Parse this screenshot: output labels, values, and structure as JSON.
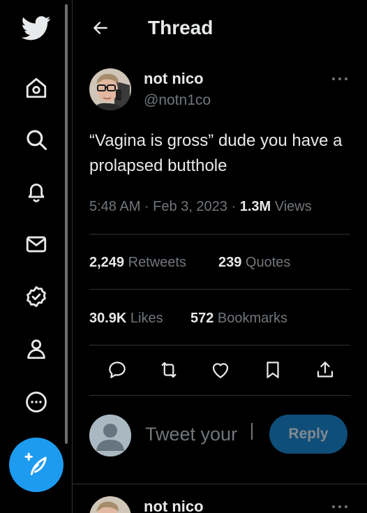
{
  "header": {
    "title": "Thread"
  },
  "tweet": {
    "author": {
      "display_name": "not nico",
      "handle": "@notn1co"
    },
    "text": "“Vagina is gross” dude you have a prolapsed butthole",
    "time": "5:48 AM",
    "sep1": " · ",
    "date": "Feb 3, 2023",
    "sep2": " · ",
    "views_count": "1.3M",
    "views_label": " Views",
    "stats": {
      "retweets_count": "2,249",
      "retweets_label": " Retweets",
      "quotes_count": "239",
      "quotes_label": " Quotes",
      "likes_count": "30.9K",
      "likes_label": " Likes",
      "bookmarks_count": "572",
      "bookmarks_label": " Bookmarks"
    }
  },
  "reply": {
    "placeholder": "Tweet your",
    "button_label": "Reply"
  },
  "next_tweet": {
    "display_name": "not nico"
  },
  "sidebar": {
    "items": [
      "twitter-logo",
      "home",
      "explore",
      "notifications",
      "messages",
      "verified",
      "profile",
      "more"
    ]
  },
  "colors": {
    "accent": "#1d9bf0",
    "muted": "#71767b",
    "text": "#e7e9ea",
    "border": "#2f3336"
  }
}
